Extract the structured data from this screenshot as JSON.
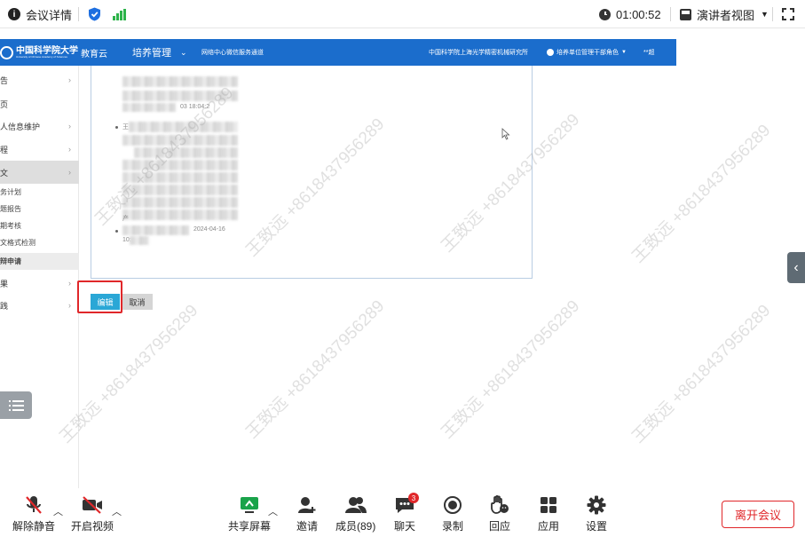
{
  "topbar": {
    "meeting_info": "会议详情",
    "timer": "01:00:52",
    "view_mode": "演讲者视图"
  },
  "app": {
    "logo_text": "中国科学院大学",
    "logo_subtitle": "University of Chinese Academy of Sciences",
    "brand": "教育云",
    "module": "培养管理",
    "channel": "网络中心微信服务通道",
    "institute": "中国科学院上海光学精密机械研究所",
    "user_role": "培养单位管理干部角色",
    "extra": "**超"
  },
  "sidebar": {
    "items": [
      {
        "label": "告",
        "arrow": "›"
      },
      {
        "label": "页",
        "arrow": ""
      },
      {
        "label": "人信息维护",
        "arrow": "›"
      },
      {
        "label": "程",
        "arrow": "›"
      },
      {
        "label": "文",
        "arrow": "›"
      }
    ],
    "subitems": [
      "务计划",
      "题报告",
      "期考核",
      "文格式检测",
      "辩申请"
    ],
    "items_bottom": [
      {
        "label": "果",
        "arrow": "›"
      },
      {
        "label": "践",
        "arrow": "›"
      }
    ]
  },
  "panel": {
    "timestamp1": "03 18:04:2",
    "entry2_prefix": "王",
    "entry2_suffix": "产",
    "timestamp2": "2024-04-16",
    "timestamp2_time": "10:"
  },
  "buttons": {
    "edit": "编辑",
    "cancel": "取消"
  },
  "watermark": "王致远 +8618437956289",
  "toolbar": {
    "mute": "解除静音",
    "video": "开启视频",
    "share": "共享屏幕",
    "invite": "邀请",
    "members": "成员(89)",
    "chat": "聊天",
    "chat_badge": "3",
    "record": "录制",
    "reaction": "回应",
    "apps": "应用",
    "settings": "设置",
    "leave": "离开会议"
  },
  "colors": {
    "appbar": "#1b6dcc",
    "edit_button": "#2aa7d6",
    "highlight": "#e0272a",
    "share_icon": "#1aa34a"
  }
}
